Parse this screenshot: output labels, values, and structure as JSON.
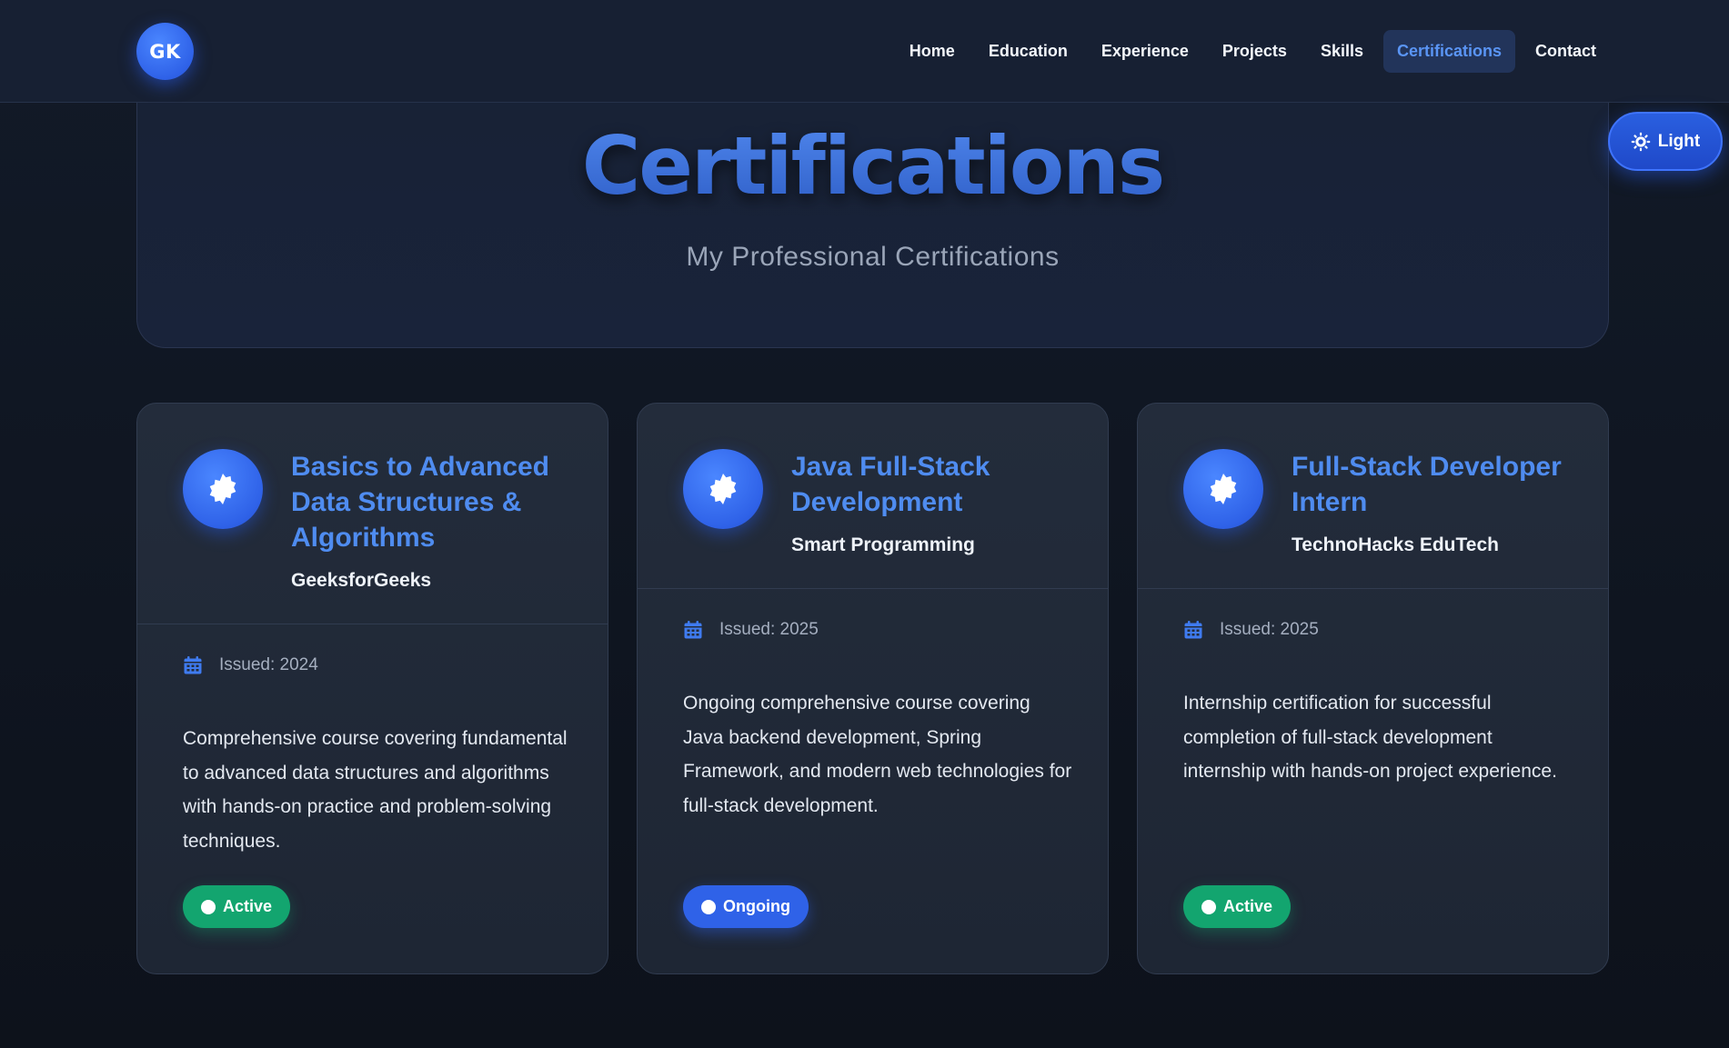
{
  "header": {
    "logo_text": "GK",
    "nav": [
      {
        "label": "Home"
      },
      {
        "label": "Education"
      },
      {
        "label": "Experience"
      },
      {
        "label": "Projects"
      },
      {
        "label": "Skills"
      },
      {
        "label": "Certifications",
        "active": true
      },
      {
        "label": "Contact"
      }
    ]
  },
  "theme_toggle": {
    "label": "Light",
    "icon": "sun-icon"
  },
  "hero": {
    "title": "Certifications",
    "subtitle": "My Professional Certifications"
  },
  "certifications": [
    {
      "title": "Basics to Advanced Data Structures & Algorithms",
      "issuer": "GeeksforGeeks",
      "issued": "Issued: 2024",
      "description": "Comprehensive course covering fundamental to advanced data structures and algorithms with hands-on practice and problem-solving techniques.",
      "status": "Active",
      "status_color": "#13a56f"
    },
    {
      "title": "Java Full-Stack Development",
      "issuer": "Smart Programming",
      "issued": "Issued: 2025",
      "description": "Ongoing comprehensive course covering Java backend development, Spring Framework, and modern web technologies for full-stack development.",
      "status": "Ongoing",
      "status_color": "#2f62e8"
    },
    {
      "title": "Full-Stack Developer Intern",
      "issuer": "TechnoHacks EduTech",
      "issued": "Issued: 2025",
      "description": "Internship certification for successful completion of full-stack development internship with hands-on project experience.",
      "status": "Active",
      "status_color": "#13a56f"
    }
  ],
  "colors": {
    "accent": "#4f8cf0",
    "background": "#121a28",
    "card": "#232c3b"
  }
}
